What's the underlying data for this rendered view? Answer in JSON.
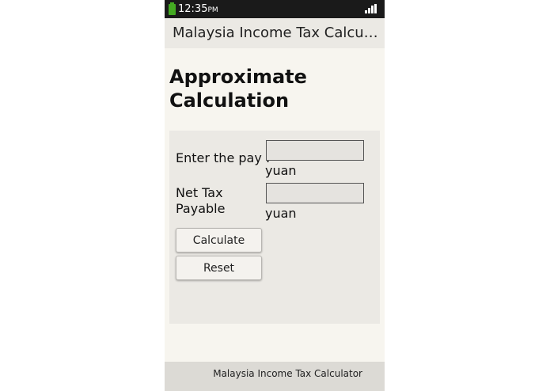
{
  "status_bar": {
    "time": "12:35",
    "ampm": "PM",
    "battery_icon": "battery-charging-icon",
    "signal_icon": "signal-strength-icon",
    "battery_color": "#44aa22"
  },
  "title_bar": {
    "title": "Malaysia Income Tax Calculator"
  },
  "main": {
    "heading": "Approximate Calculation",
    "pay_label": "Enter the pay :",
    "pay_value": "",
    "pay_unit": "yuan",
    "tax_label": "Net Tax Payable",
    "tax_value": "",
    "tax_unit": "yuan",
    "calculate_label": "Calculate",
    "reset_label": "Reset"
  },
  "bottom_bar": {
    "label": "Malaysia Income Tax Calculator"
  }
}
